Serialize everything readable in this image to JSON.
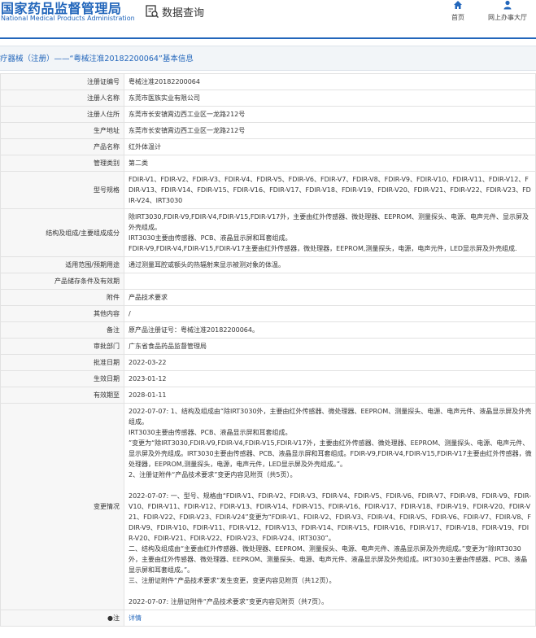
{
  "header": {
    "logo_cn": "国家药品监督管理局",
    "logo_en": "National Medical Products Administration",
    "query_label": "数据查询",
    "nav_home": "首页",
    "nav_office": "网上办事大厅",
    "brand_color": "#2266bb"
  },
  "title": "疗器械（注册）——“粤械注准20182200064”基本信息",
  "rows": {
    "reg_no": {
      "label": "注册证编号",
      "value": "粤械注准20182200064"
    },
    "registrant": {
      "label": "注册人名称",
      "value": "东莞市医族实业有限公司"
    },
    "registrant_addr": {
      "label": "注册人住所",
      "value": "东莞市长安镇霄边西工业区一龙路212号"
    },
    "production_addr": {
      "label": "生产地址",
      "value": "东莞市长安镇霄边西工业区一龙路212号"
    },
    "product_name": {
      "label": "产品名称",
      "value": "红外体温计"
    },
    "category": {
      "label": "管理类别",
      "value": "第二类"
    },
    "models": {
      "label": "型号规格",
      "value": "FDIR-V1、FDIR-V2、FDIR-V3、FDIR-V4、FDIR-V5、FDIR-V6、FDIR-V7、FDIR-V8、FDIR-V9、FDIR-V10、FDIR-V11、FDIR-V12、FDIR-V13、FDIR-V14、FDIR-V15、FDIR-V16、FDIR-V17、FDIR-V18、FDIR-V19、FDIR-V20、FDIR-V21、FDIR-V22、FDIR-V23、FDIR-V24、IRT3030"
    },
    "structure": {
      "label": "结构及组成/主要组成成分",
      "value": "除IRT3030,FDIR-V9,FDIR-V4,FDIR-V15,FDIR-V17外，主要由红外传感器、微处理器、EEPROM、测量探头、电源、电声元件、显示屏及外壳组成。\nIRT3030主要由传感器、PCB、液晶显示屏和耳套组成。\nFDIR-V9,FDIR-V4,FDIR-V15,FDIR-V17主要由红外传感器，微处理器，EEPROM,测量探头，电源，电声元件，LED显示屏及外壳组成."
    },
    "scope": {
      "label": "适用范围/预期用途",
      "value": "通过测量耳腔或额头的热辐射来显示被测对象的体温。"
    },
    "storage": {
      "label": "产品储存条件及有效期",
      "value": ""
    },
    "attachment": {
      "label": "附件",
      "value": "产品技术要求"
    },
    "other": {
      "label": "其他内容",
      "value": "/"
    },
    "remark": {
      "label": "备注",
      "value": "原产品注册证号：粤械注准20182200064。"
    },
    "approval_dept": {
      "label": "审批部门",
      "value": "广东省食品药品监督管理局"
    },
    "approval_date": {
      "label": "批准日期",
      "value": "2022-03-22"
    },
    "effective_date": {
      "label": "生效日期",
      "value": "2023-01-12"
    },
    "expiry_date": {
      "label": "有效期至",
      "value": "2028-01-11"
    },
    "changes": {
      "label": "变更情况",
      "p1": "2022-07-07: 1、结构及组成由“除IRT3030外，主要由红外传感器、微处理器、EEPROM、测量探头、电源、电声元件、液晶显示屏及外壳组成。\nIRT3030主要由传感器、PCB、液晶显示屏和耳套组成。\n”变更为“除IRT3030,FDIR-V9,FDIR-V4,FDIR-V15,FDIR-V17外，主要由红外传感器、微处理器、EEPROM、测量探头、电源、电声元件、显示屏及外壳组成。IRT3030主要由传感器、PCB、液晶显示屏和耳套组成。FDIR-V9,FDIR-V4,FDIR-V15,FDIR-V17主要由红外传感器，微处理器，EEPROM,测量探头，电源，电声元件，LED显示屏及外壳组成。”。\n2、注册证附件“产品技术要求”变更内容见附页（共5页）。",
      "p2": "2022-07-07: 一、型号、规格由“FDIR-V1、FDIR-V2、FDIR-V3、FDIR-V4、FDIR-V5、FDIR-V6、FDIR-V7、FDIR-V8、FDIR-V9、FDIR-V10、FDIR-V11、FDIR-V12、FDIR-V13、FDIR-V14、FDIR-V15、FDIR-V16、FDIR-V17、FDIR-V18、FDIR-V19、FDIR-V20、FDIR-V21、FDIR-V22、FDIR-V23、FDIR-V24”变更为“FDIR-V1、FDIR-V2、FDIR-V3、FDIR-V4、FDIR-V5、FDIR-V6、FDIR-V7、FDIR-V8、FDIR-V9、FDIR-V10、FDIR-V11、FDIR-V12、FDIR-V13、FDIR-V14、FDIR-V15、FDIR-V16、FDIR-V17、FDIR-V18、FDIR-V19、FDIR-V20、FDIR-V21、FDIR-V22、FDIR-V23、FDIR-V24、IRT3030”。\n二、结构及组成由“主要由红外传感器、微处理器、EEPROM、测量探头、电源、电声元件、液晶显示屏及外壳组成。”变更为“除IRT3030外，主要由红外传感器、微处理器、EEPROM、测量探头、电源、电声元件、液晶显示屏及外壳组成。IRT3030主要由传感器、PCB、液晶显示屏和耳套组成。”。\n三、注册证附件“产品技术要求”发生变更，变更内容见附页（共12页）。",
      "p3": "2022-07-07: 注册证附件“产品技术要求”变更内容见附页（共7页）。"
    },
    "note": {
      "label": "注",
      "value": "详情"
    }
  }
}
